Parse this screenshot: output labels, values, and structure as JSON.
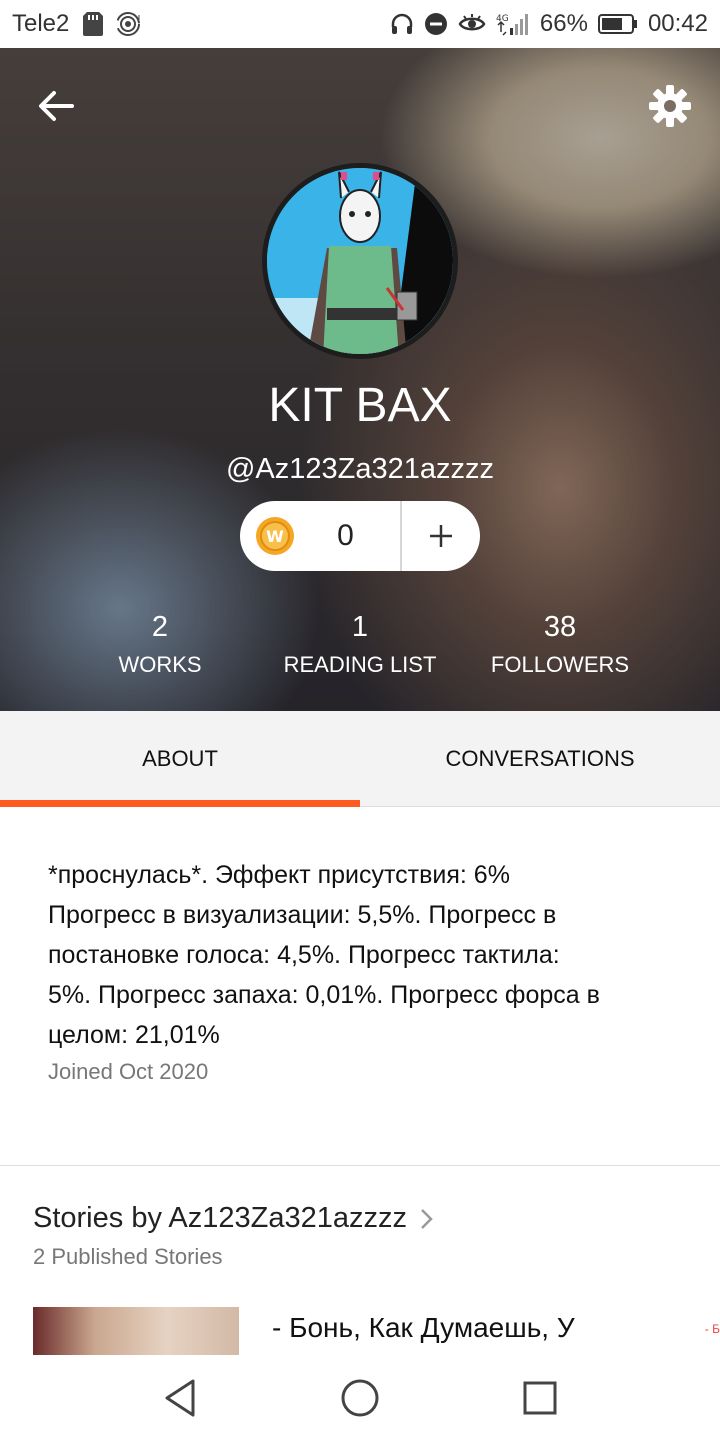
{
  "status_bar": {
    "carrier": "Tele2",
    "network": "4G",
    "battery": "66%",
    "time": "00:42",
    "icons": [
      "sd-card-icon",
      "hotspot-icon",
      "headphones-icon",
      "dnd-icon",
      "eye-icon",
      "signal-icon",
      "battery-icon"
    ]
  },
  "header": {
    "display_name": "KIT BAX",
    "username": "@Az123Za321azzzz",
    "coins": {
      "count": "0",
      "coin_symbol": "W",
      "add_symbol": "+"
    },
    "stats": [
      {
        "value": "2",
        "label": "WORKS"
      },
      {
        "value": "1",
        "label": "READING LIST"
      },
      {
        "value": "38",
        "label": "FOLLOWERS"
      }
    ]
  },
  "tabs": [
    {
      "label": "ABOUT",
      "active": true
    },
    {
      "label": "CONVERSATIONS",
      "active": false
    }
  ],
  "about": {
    "bio_lines": [
      "*проснулась*. Эффект присутствия: 6%",
      "Прогресс в визуализации: 5,5%. Прогресс в",
      "постановке голоса: 4,5%. Прогресс тактила:",
      "5%. Прогресс запаха: 0,01%. Прогресс форса в",
      "целом: 21,01%"
    ],
    "joined": "Joined Oct 2020"
  },
  "stories": {
    "title": "Stories by Az123Za321azzzz",
    "count_label": "2 Published Stories",
    "first_story_title": "- Бонь, Как Думаешь, У",
    "tag_snippet": "- Б"
  },
  "colors": {
    "accent": "#ff5a1f",
    "coin": "#f5a623",
    "tabs_bg": "#f4f3f4"
  }
}
